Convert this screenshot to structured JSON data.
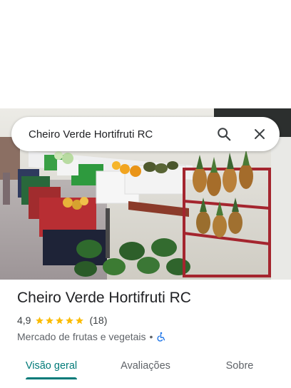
{
  "search": {
    "query": "Cheiro Verde Hortifruti RC",
    "search_icon": "search-icon",
    "close_icon": "close-icon"
  },
  "hero_photo": {
    "subject": "produce-stand-photo"
  },
  "place": {
    "title": "Cheiro Verde Hortifruti RC",
    "rating": "4,9",
    "stars": 5,
    "review_count": "(18)",
    "category": "Mercado de frutas e vegetais",
    "separator": "•",
    "accessibility_icon": "wheelchair-icon"
  },
  "tabs": [
    {
      "label": "Visão geral",
      "active": true
    },
    {
      "label": "Avaliações",
      "active": false
    },
    {
      "label": "Sobre",
      "active": false
    }
  ],
  "colors": {
    "accent": "#007a78",
    "star": "#fbbc04",
    "accessibility": "#1a73e8"
  }
}
